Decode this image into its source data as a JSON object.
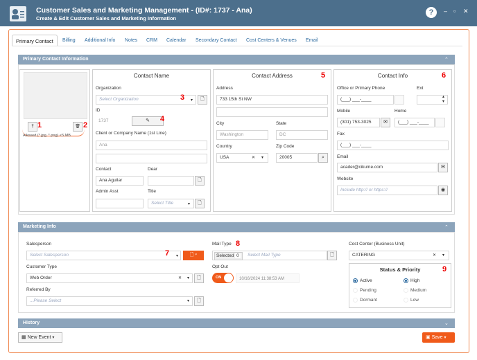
{
  "window": {
    "title": "Customer Sales and Marketing Management - (ID#: 1737 - Ana)",
    "subtitle": "Create & Edit Customer Sales and Marketing Information",
    "help": "?",
    "min": "–",
    "max": "▫",
    "close": "✕"
  },
  "tabs": [
    "Primary Contact",
    "Billing",
    "Additional Info",
    "Notes",
    "CRM",
    "Calendar",
    "Secondary Contact",
    "Cost Centers & Venues",
    "Email"
  ],
  "primary": {
    "header": "Primary Contact Information",
    "photo": {
      "upload": "⇪",
      "delete": "🗑",
      "note": "Allowed (*.jpg, *.png) <5 MB"
    },
    "name": {
      "title": "Contact Name",
      "org_label": "Organization",
      "org_placeholder": "Select Organization",
      "id_label": "ID",
      "id_value": "1737",
      "company_label": "Client or Company Name (1st Line)",
      "company_value": "Ana",
      "company2_value": "",
      "contact_label": "Contact",
      "contact_value": "Ana Aguilar",
      "dear_label": "Dear",
      "dear_value": "",
      "asst_label": "Admin Asst",
      "asst_value": "",
      "title_label": "Title",
      "title_placeholder": "Select Title"
    },
    "address": {
      "title": "Contact Address",
      "addr_label": "Address",
      "addr1": "733 15th St NW",
      "addr2": "",
      "city_label": "City",
      "city_value": "Washington",
      "state_label": "State",
      "state_value": "DC",
      "country_label": "Country",
      "country_value": "USA",
      "zip_label": "Zip Code",
      "zip_value": "20005"
    },
    "info": {
      "title": "Contact Info",
      "office_label": "Office or Primary Phone",
      "office_value": "(___) ___-____",
      "ext_label": "Ext",
      "mobile_label": "Mobile",
      "mobile_value": "(301) 753-3025",
      "home_label": "Home",
      "home_value": "(___) ___-____",
      "fax_label": "Fax",
      "fax_value": "(___) ___-____",
      "email_label": "Email",
      "email_value": "acader@cikume.com",
      "web_label": "Website",
      "web_placeholder": "Include http:// or https://"
    }
  },
  "marketing": {
    "header": "Marketing Info",
    "sales_label": "Salesperson",
    "sales_placeholder": "Select Salesperson",
    "ctype_label": "Customer Type",
    "ctype_value": "Web Order",
    "ref_label": "Referred By",
    "ref_placeholder": "...Please Select",
    "mail_label": "Mail Type",
    "mail_selected": "Selected",
    "mail_count": "0",
    "mail_placeholder": "Select Mail Type",
    "optout_label": "Opt Out",
    "optout_toggle": "ON",
    "optout_date": "10/16/2024 11:38:53 AM",
    "cc_label": "Cost Center (Business Unit)",
    "cc_value": "CATERING",
    "status": {
      "title": "Status & Priority",
      "left": [
        "Active",
        "Pending",
        "Dormant"
      ],
      "right": [
        "High",
        "Medium",
        "Low"
      ],
      "selected_left": "Active",
      "selected_right": "High"
    }
  },
  "history": {
    "header": "History"
  },
  "footer": {
    "new_event": "New Event",
    "save": "Save"
  },
  "callouts": [
    "1",
    "2",
    "3",
    "4",
    "5",
    "6",
    "7",
    "8",
    "9"
  ],
  "colors": {
    "titlebar": "#4c6f8c",
    "section": "#8ca4bb",
    "accent": "#f05a1a",
    "link": "#2d6a9f",
    "callout": "#e00000"
  }
}
